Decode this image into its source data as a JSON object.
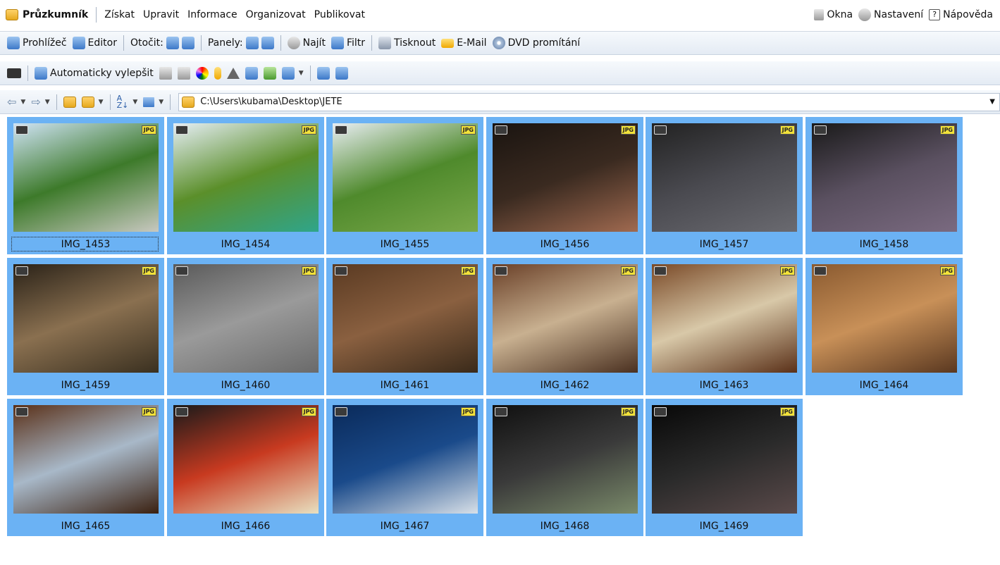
{
  "menubar": {
    "app_title": "Průzkumník",
    "items": [
      "Získat",
      "Upravit",
      "Informace",
      "Organizovat",
      "Publikovat"
    ],
    "right": {
      "windows": "Okna",
      "settings": "Nastavení",
      "help": "Nápověda"
    }
  },
  "toolbar1": {
    "viewer": "Prohlížeč",
    "editor": "Editor",
    "rotate_label": "Otočit:",
    "panels_label": "Panely:",
    "find": "Najít",
    "filter": "Filtr",
    "print": "Tisknout",
    "email": "E-Mail",
    "dvd": "DVD promítání"
  },
  "toolbar2": {
    "auto_enhance": "Automaticky vylepšit"
  },
  "address": {
    "path": "C:\\Users\\kubama\\Desktop\\JETE"
  },
  "thumbnails": [
    {
      "name": "IMG_1453",
      "icon": "camera-icon",
      "badge": "JPG",
      "colors": [
        "#cfe3f5",
        "#3d7a2a",
        "#c8c8c0"
      ]
    },
    {
      "name": "IMG_1454",
      "icon": "camera-icon",
      "badge": "JPG",
      "colors": [
        "#e6eef5",
        "#5b8f2a",
        "#2fa58a"
      ]
    },
    {
      "name": "IMG_1455",
      "icon": "camera-icon",
      "badge": "JPG",
      "colors": [
        "#e8edf2",
        "#4f8a2c",
        "#7aa84a"
      ]
    },
    {
      "name": "IMG_1456",
      "icon": "camera-icon",
      "badge": "JPG",
      "colors": [
        "#1a1410",
        "#3a2a20",
        "#a06a50"
      ]
    },
    {
      "name": "IMG_1457",
      "icon": "camera-icon",
      "badge": "JPG",
      "colors": [
        "#222222",
        "#4a4a50",
        "#6a6a70"
      ]
    },
    {
      "name": "IMG_1458",
      "icon": "camera-icon",
      "badge": "JPG",
      "colors": [
        "#1a1a1a",
        "#5a5060",
        "#7a6a80"
      ]
    },
    {
      "name": "IMG_1459",
      "icon": "camera-icon",
      "badge": "JPG",
      "colors": [
        "#2a2218",
        "#8a7050",
        "#3a3020"
      ]
    },
    {
      "name": "IMG_1460",
      "icon": "camera-icon",
      "badge": "JPG",
      "colors": [
        "#5a5a5a",
        "#9a9a9a",
        "#6a6a6a"
      ]
    },
    {
      "name": "IMG_1461",
      "icon": "camera-icon",
      "badge": "JPG",
      "colors": [
        "#5a3a22",
        "#8a6040",
        "#3a2a1a"
      ]
    },
    {
      "name": "IMG_1462",
      "icon": "camera-icon",
      "badge": "JPG",
      "colors": [
        "#6a4028",
        "#c8b090",
        "#4a3020"
      ]
    },
    {
      "name": "IMG_1463",
      "icon": "camera-icon",
      "badge": "JPG",
      "colors": [
        "#7a4a28",
        "#d8c8a8",
        "#5a3018"
      ]
    },
    {
      "name": "IMG_1464",
      "icon": "camera-icon",
      "badge": "JPG",
      "colors": [
        "#8a5a30",
        "#c89058",
        "#5a3820"
      ]
    },
    {
      "name": "IMG_1465",
      "icon": "camera-icon",
      "badge": "JPG",
      "colors": [
        "#5a3018",
        "#a8b8c8",
        "#3a2010"
      ]
    },
    {
      "name": "IMG_1466",
      "icon": "camera-icon",
      "badge": "JPG",
      "colors": [
        "#1a1a1a",
        "#c83a20",
        "#e8e0c0"
      ]
    },
    {
      "name": "IMG_1467",
      "icon": "camera-icon",
      "badge": "JPG",
      "colors": [
        "#0a2a5a",
        "#1a4a8a",
        "#d8e0e8"
      ]
    },
    {
      "name": "IMG_1468",
      "icon": "camera-icon",
      "badge": "JPG",
      "colors": [
        "#101010",
        "#3a3a3a",
        "#7a8a6a"
      ]
    },
    {
      "name": "IMG_1469",
      "icon": "camera-icon",
      "badge": "JPG",
      "colors": [
        "#080808",
        "#2a2a2a",
        "#5a4a4a"
      ]
    }
  ],
  "selection_color": "#6bb2f4"
}
